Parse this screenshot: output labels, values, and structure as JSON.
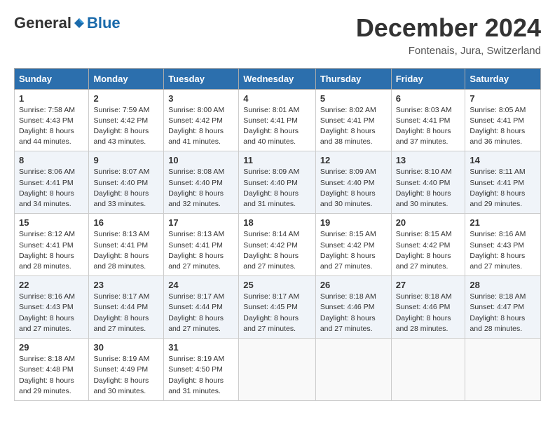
{
  "logo": {
    "general": "General",
    "blue": "Blue"
  },
  "title": {
    "month_year": "December 2024",
    "location": "Fontenais, Jura, Switzerland"
  },
  "weekdays": [
    "Sunday",
    "Monday",
    "Tuesday",
    "Wednesday",
    "Thursday",
    "Friday",
    "Saturday"
  ],
  "weeks": [
    [
      {
        "day": "1",
        "info": "Sunrise: 7:58 AM\nSunset: 4:43 PM\nDaylight: 8 hours\nand 44 minutes."
      },
      {
        "day": "2",
        "info": "Sunrise: 7:59 AM\nSunset: 4:42 PM\nDaylight: 8 hours\nand 43 minutes."
      },
      {
        "day": "3",
        "info": "Sunrise: 8:00 AM\nSunset: 4:42 PM\nDaylight: 8 hours\nand 41 minutes."
      },
      {
        "day": "4",
        "info": "Sunrise: 8:01 AM\nSunset: 4:41 PM\nDaylight: 8 hours\nand 40 minutes."
      },
      {
        "day": "5",
        "info": "Sunrise: 8:02 AM\nSunset: 4:41 PM\nDaylight: 8 hours\nand 38 minutes."
      },
      {
        "day": "6",
        "info": "Sunrise: 8:03 AM\nSunset: 4:41 PM\nDaylight: 8 hours\nand 37 minutes."
      },
      {
        "day": "7",
        "info": "Sunrise: 8:05 AM\nSunset: 4:41 PM\nDaylight: 8 hours\nand 36 minutes."
      }
    ],
    [
      {
        "day": "8",
        "info": "Sunrise: 8:06 AM\nSunset: 4:41 PM\nDaylight: 8 hours\nand 34 minutes."
      },
      {
        "day": "9",
        "info": "Sunrise: 8:07 AM\nSunset: 4:40 PM\nDaylight: 8 hours\nand 33 minutes."
      },
      {
        "day": "10",
        "info": "Sunrise: 8:08 AM\nSunset: 4:40 PM\nDaylight: 8 hours\nand 32 minutes."
      },
      {
        "day": "11",
        "info": "Sunrise: 8:09 AM\nSunset: 4:40 PM\nDaylight: 8 hours\nand 31 minutes."
      },
      {
        "day": "12",
        "info": "Sunrise: 8:09 AM\nSunset: 4:40 PM\nDaylight: 8 hours\nand 30 minutes."
      },
      {
        "day": "13",
        "info": "Sunrise: 8:10 AM\nSunset: 4:40 PM\nDaylight: 8 hours\nand 30 minutes."
      },
      {
        "day": "14",
        "info": "Sunrise: 8:11 AM\nSunset: 4:41 PM\nDaylight: 8 hours\nand 29 minutes."
      }
    ],
    [
      {
        "day": "15",
        "info": "Sunrise: 8:12 AM\nSunset: 4:41 PM\nDaylight: 8 hours\nand 28 minutes."
      },
      {
        "day": "16",
        "info": "Sunrise: 8:13 AM\nSunset: 4:41 PM\nDaylight: 8 hours\nand 28 minutes."
      },
      {
        "day": "17",
        "info": "Sunrise: 8:13 AM\nSunset: 4:41 PM\nDaylight: 8 hours\nand 27 minutes."
      },
      {
        "day": "18",
        "info": "Sunrise: 8:14 AM\nSunset: 4:42 PM\nDaylight: 8 hours\nand 27 minutes."
      },
      {
        "day": "19",
        "info": "Sunrise: 8:15 AM\nSunset: 4:42 PM\nDaylight: 8 hours\nand 27 minutes."
      },
      {
        "day": "20",
        "info": "Sunrise: 8:15 AM\nSunset: 4:42 PM\nDaylight: 8 hours\nand 27 minutes."
      },
      {
        "day": "21",
        "info": "Sunrise: 8:16 AM\nSunset: 4:43 PM\nDaylight: 8 hours\nand 27 minutes."
      }
    ],
    [
      {
        "day": "22",
        "info": "Sunrise: 8:16 AM\nSunset: 4:43 PM\nDaylight: 8 hours\nand 27 minutes."
      },
      {
        "day": "23",
        "info": "Sunrise: 8:17 AM\nSunset: 4:44 PM\nDaylight: 8 hours\nand 27 minutes."
      },
      {
        "day": "24",
        "info": "Sunrise: 8:17 AM\nSunset: 4:44 PM\nDaylight: 8 hours\nand 27 minutes."
      },
      {
        "day": "25",
        "info": "Sunrise: 8:17 AM\nSunset: 4:45 PM\nDaylight: 8 hours\nand 27 minutes."
      },
      {
        "day": "26",
        "info": "Sunrise: 8:18 AM\nSunset: 4:46 PM\nDaylight: 8 hours\nand 27 minutes."
      },
      {
        "day": "27",
        "info": "Sunrise: 8:18 AM\nSunset: 4:46 PM\nDaylight: 8 hours\nand 28 minutes."
      },
      {
        "day": "28",
        "info": "Sunrise: 8:18 AM\nSunset: 4:47 PM\nDaylight: 8 hours\nand 28 minutes."
      }
    ],
    [
      {
        "day": "29",
        "info": "Sunrise: 8:18 AM\nSunset: 4:48 PM\nDaylight: 8 hours\nand 29 minutes."
      },
      {
        "day": "30",
        "info": "Sunrise: 8:19 AM\nSunset: 4:49 PM\nDaylight: 8 hours\nand 30 minutes."
      },
      {
        "day": "31",
        "info": "Sunrise: 8:19 AM\nSunset: 4:50 PM\nDaylight: 8 hours\nand 31 minutes."
      },
      {
        "day": "",
        "info": ""
      },
      {
        "day": "",
        "info": ""
      },
      {
        "day": "",
        "info": ""
      },
      {
        "day": "",
        "info": ""
      }
    ]
  ]
}
